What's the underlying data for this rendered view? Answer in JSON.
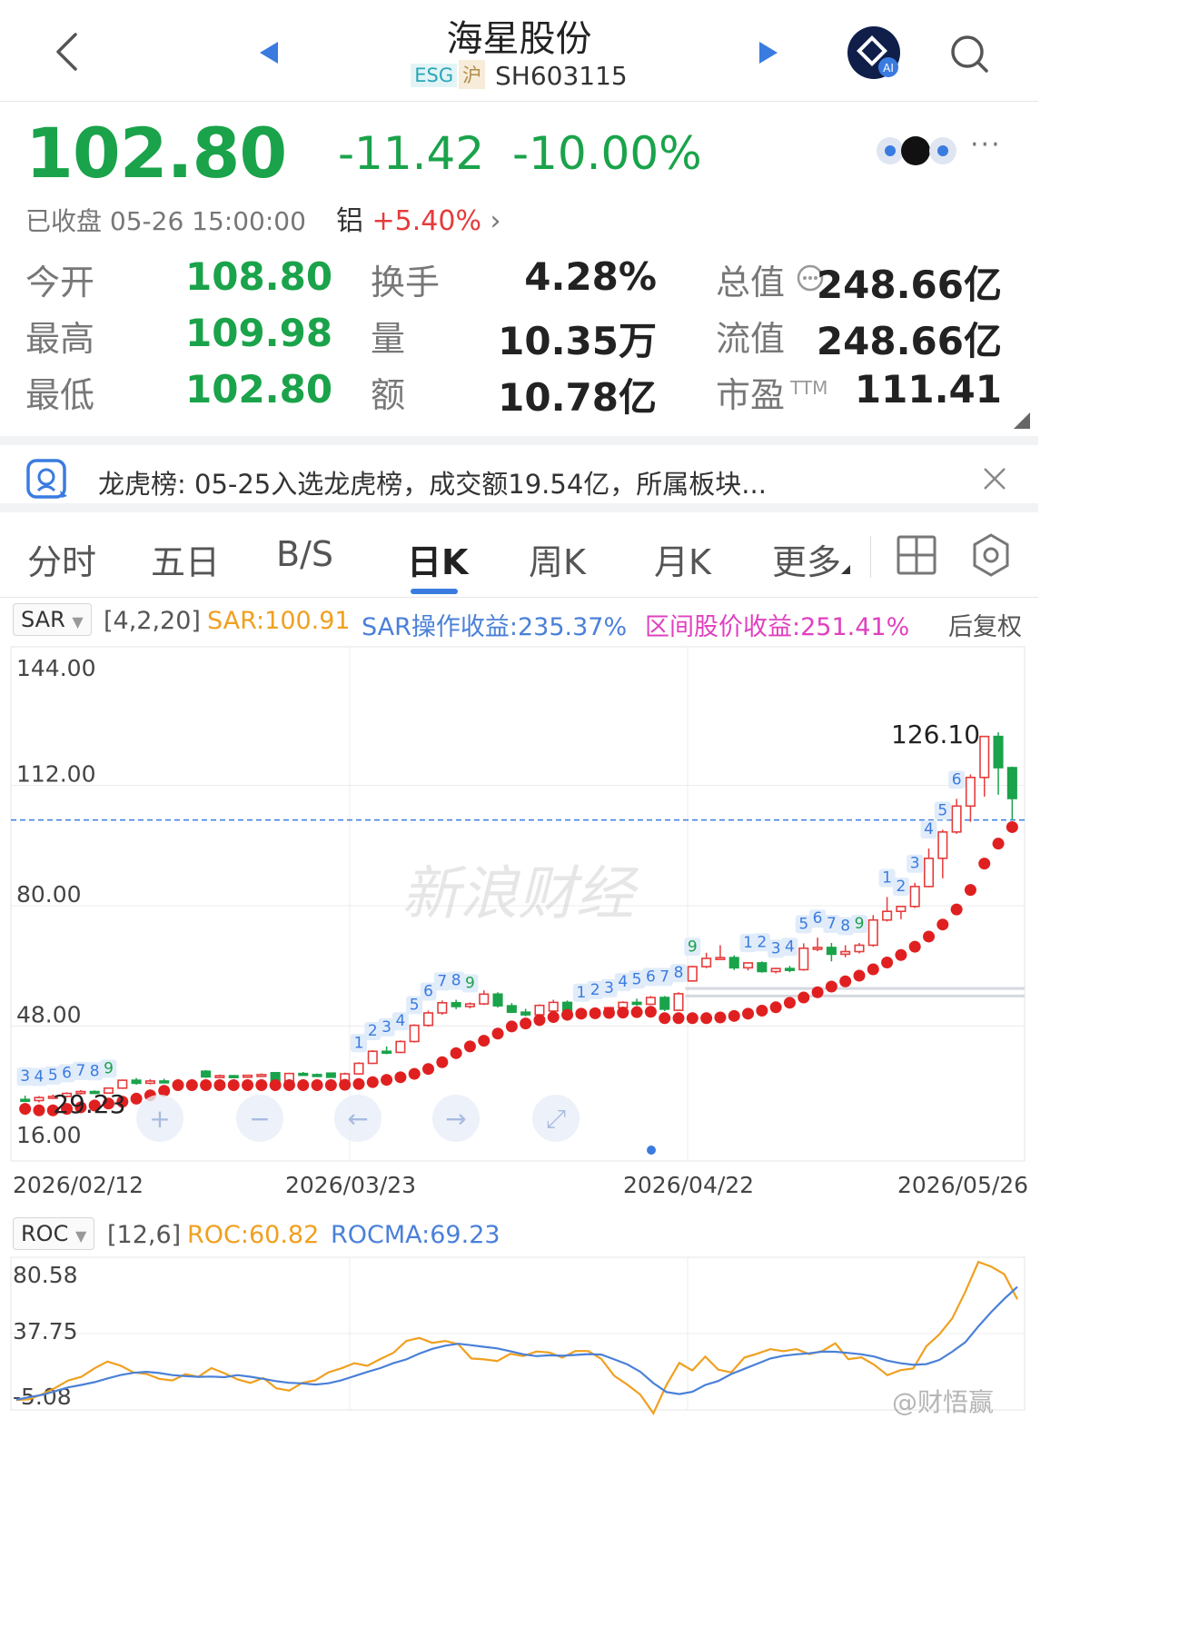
{
  "header": {
    "title": "海星股份",
    "tag_esg": "ESG",
    "tag_exchange": "沪",
    "code": "SH603115",
    "ai_badge": "AI"
  },
  "quote": {
    "price": "102.80",
    "change": "-11.42",
    "change_pct": "-10.00%",
    "status": "已收盘 05-26 15:00:00",
    "related_name": "铝",
    "related_pct": "+5.40%"
  },
  "stats": [
    [
      {
        "label": "今开",
        "value": "108.80"
      },
      {
        "label": "换手",
        "value": "4.28%"
      },
      {
        "label": "总值",
        "value": "248.66亿"
      }
    ],
    [
      {
        "label": "最高",
        "value": "109.98"
      },
      {
        "label": "量",
        "value": "10.35万"
      },
      {
        "label": "流值",
        "value": "248.66亿"
      }
    ],
    [
      {
        "label": "最低",
        "value": "102.80"
      },
      {
        "label": "额",
        "value": "10.78亿"
      },
      {
        "label": "市盈",
        "value": "111.41"
      }
    ]
  ],
  "pe_sup": "TTM",
  "banner": {
    "text": "龙虎榜: 05-25入选龙虎榜，成交额19.54亿，所属板块..."
  },
  "tabs": [
    "分时",
    "五日",
    "B/S",
    "日K",
    "周K",
    "月K",
    "更多"
  ],
  "active_tab": "日K",
  "sar": {
    "name": "SAR",
    "params": "[4,2,20]",
    "value_text": "SAR:100.91",
    "op_text": "SAR操作收益:235.37%",
    "range_text": "区间股价收益:251.41%",
    "adjust": "后复权"
  },
  "roc": {
    "name": "ROC",
    "params": "[12,6]",
    "roc_text": "ROC:60.82",
    "rocma_text": "ROCMA:69.23"
  },
  "watermark": "新浪财经",
  "footer_watermark": "@财悟赢",
  "colors": {
    "up": "#e63b3b",
    "down": "#1aa34a",
    "sar": "#e02020",
    "roc": "#f0a020",
    "rocma": "#4a80d8",
    "accent": "#3a7be0"
  },
  "chart_data": [
    {
      "type": "candlestick",
      "y_ticks": [
        "144.00",
        "112.00",
        "80.00",
        "48.00",
        "16.00"
      ],
      "ylim": [
        16,
        144
      ],
      "x_labels": [
        "2026/02/12",
        "2026/03/23",
        "2026/04/22",
        "2026/05/26"
      ],
      "high_annotation": "126.10",
      "low_annotation": "29.23",
      "last_close": 102.8,
      "series": [
        {
          "name": "K",
          "values": [
            [
              28.5,
              29.5,
              27.8,
              28.2
            ],
            [
              28.2,
              29.4,
              27.7,
              29.0
            ],
            [
              29,
              29.8,
              28.6,
              29.3
            ],
            [
              29.3,
              30.4,
              29.0,
              30.1
            ],
            [
              30.1,
              31.0,
              29.8,
              30.6
            ],
            [
              30.6,
              30.9,
              29.9,
              30.2
            ],
            [
              30.2,
              31.6,
              30.0,
              31.5
            ],
            [
              31.5,
              33.8,
              31.3,
              33.6
            ],
            [
              33.6,
              34.2,
              32.4,
              32.8
            ],
            [
              32.8,
              33.9,
              32.5,
              33.4
            ],
            [
              33.4,
              34.0,
              32.8,
              33.0
            ],
            [
              33,
              33.5,
              31.9,
              32.2
            ],
            [
              32.2,
              32.8,
              31.6,
              32.5
            ],
            [
              36,
              36.3,
              34.2,
              34.5
            ],
            [
              34.5,
              35.1,
              34.1,
              34.8
            ],
            [
              34.8,
              35.0,
              34.3,
              34.6
            ],
            [
              34.6,
              35.0,
              34.2,
              34.9
            ],
            [
              34.9,
              35.4,
              34.6,
              35.1
            ],
            [
              35.6,
              35.7,
              33.1,
              33.2
            ],
            [
              33.2,
              35.6,
              33.0,
              35.4
            ],
            [
              35.4,
              35.8,
              34.9,
              35.1
            ],
            [
              35.1,
              35.4,
              34.6,
              35.0
            ],
            [
              35.5,
              35.6,
              34.3,
              34.4
            ],
            [
              33.3,
              35.6,
              33.1,
              35.3
            ],
            [
              35.3,
              38.4,
              35.1,
              38.1
            ],
            [
              38.1,
              41.6,
              37.9,
              41.3
            ],
            [
              41.3,
              42.6,
              40.5,
              41.0
            ],
            [
              41,
              44.2,
              40.8,
              43.9
            ],
            [
              43.9,
              48.5,
              43.6,
              48.2
            ],
            [
              48.2,
              52.1,
              47.8,
              51.5
            ],
            [
              51.5,
              54.8,
              51.0,
              54.2
            ],
            [
              54.2,
              55.0,
              52.5,
              53.2
            ],
            [
              53.2,
              54.3,
              52.7,
              53.9
            ],
            [
              53.9,
              57.5,
              53.6,
              56.5
            ],
            [
              56.5,
              57.0,
              52.9,
              53.4
            ],
            [
              53.4,
              54.1,
              51.5,
              51.7
            ],
            [
              51.7,
              52.6,
              50.6,
              51.0
            ],
            [
              51,
              53.8,
              50.7,
              53.5
            ],
            [
              52,
              55.0,
              51.8,
              54.3
            ],
            [
              54.3,
              54.8,
              51.2,
              51.5
            ],
            [
              50.5,
              51.8,
              49.8,
              51.3
            ],
            [
              51.3,
              52.5,
              51.0,
              52.3
            ],
            [
              52.3,
              53.0,
              51.6,
              52.9
            ],
            [
              52.9,
              54.6,
              52.6,
              54.3
            ],
            [
              54.3,
              55.3,
              53.4,
              53.8
            ],
            [
              53.8,
              56.0,
              53.6,
              55.6
            ],
            [
              55.6,
              56.0,
              52.0,
              52.5
            ],
            [
              52.2,
              57.0,
              52.0,
              56.6
            ],
            [
              60,
              64.0,
              59.8,
              63.8
            ],
            [
              63.8,
              67.5,
              63.4,
              66.0
            ],
            [
              66,
              69.5,
              65.8,
              66.2
            ],
            [
              66.2,
              66.8,
              62.9,
              63.5
            ],
            [
              63.5,
              65.0,
              62.8,
              64.8
            ],
            [
              64.8,
              65.2,
              62.2,
              62.5
            ],
            [
              62.5,
              63.5,
              62.0,
              63.3
            ],
            [
              63.3,
              64.0,
              62.3,
              63.0
            ],
            [
              63,
              70.0,
              62.7,
              68.7
            ],
            [
              68.7,
              71.5,
              67.9,
              68.9
            ],
            [
              68.9,
              70.1,
              65.2,
              67.1
            ],
            [
              67.1,
              69.5,
              66.3,
              67.8
            ],
            [
              67.8,
              70.1,
              67.3,
              69.5
            ],
            [
              69.5,
              77.5,
              69.1,
              76.2
            ],
            [
              76.2,
              82.3,
              75.8,
              78.5
            ],
            [
              78.5,
              80.0,
              76.4,
              79.8
            ],
            [
              79.8,
              86.1,
              79.4,
              85.1
            ],
            [
              85.1,
              95.2,
              84.9,
              92.6
            ],
            [
              92.6,
              100.2,
              87.3,
              99.6
            ],
            [
              99.6,
              108.4,
              99.1,
              106.5
            ],
            [
              106.5,
              114.9,
              102.3,
              114.1
            ],
            [
              114.1,
              125.1,
              109.0,
              125.0
            ],
            [
              125,
              126.1,
              109.5,
              116.7
            ],
            [
              116.7,
              117.0,
              102.8,
              108.5
            ]
          ]
        },
        {
          "name": "SAR",
          "values": [
            26.0,
            25.6,
            25.6,
            26.0,
            26.4,
            26.9,
            27.4,
            27.9,
            28.7,
            29.6,
            30.8,
            32.3,
            32.3,
            32.3,
            32.3,
            32.3,
            32.3,
            32.3,
            32.3,
            32.3,
            32.3,
            32.3,
            32.3,
            32.4,
            32.6,
            33.1,
            33.7,
            34.4,
            35.3,
            36.6,
            38.4,
            40.8,
            42.6,
            44.1,
            46.0,
            47.9,
            48.7,
            49.6,
            50.4,
            51.0,
            51.3,
            51.4,
            51.5,
            51.6,
            51.7,
            51.8,
            50.1,
            50.1,
            50.1,
            50.1,
            50.3,
            50.7,
            51.3,
            52.1,
            53.0,
            54.2,
            55.6,
            57.0,
            58.5,
            59.9,
            61.4,
            63.1,
            64.9,
            66.9,
            69.1,
            71.8,
            75.0,
            79.0,
            84.2,
            91.2,
            96.5,
            100.9
          ]
        }
      ],
      "sar_support_lines": [
        58.0,
        56.0
      ],
      "nav_buttons": [
        "+",
        "−",
        "←",
        "→",
        "⤢"
      ]
    },
    {
      "type": "line",
      "y_ticks": [
        "80.58",
        "37.75",
        "-5.08"
      ],
      "ylim": [
        -5.08,
        80.58
      ],
      "series": [
        {
          "name": "ROC",
          "values": [
            -7.0,
            -6.5,
            -3.0,
            1.2,
            6.2,
            8.6,
            14.3,
            18.9,
            16.2,
            11.6,
            10.6,
            7.3,
            6.2,
            10.4,
            8.6,
            14.5,
            11.1,
            7.0,
            4.5,
            7.8,
            0.9,
            -0.6,
            4.6,
            6.3,
            11.6,
            14.4,
            17.8,
            16.0,
            20.6,
            24.8,
            32.8,
            34.8,
            31.5,
            32.8,
            30.6,
            21.0,
            20.4,
            19.3,
            24.1,
            22.6,
            25.7,
            25.0,
            21.6,
            26.0,
            26.0,
            20.6,
            9.3,
            3.4,
            -3.4,
            -16.0,
            3.0,
            18.0,
            12.9,
            22.3,
            13.4,
            11.6,
            21.6,
            24.2,
            27.3,
            25.9,
            27.3,
            23.9,
            26.0,
            31.2,
            20.5,
            21.7,
            16.7,
            9.7,
            13.1,
            14.3,
            29.2,
            37.2,
            48.0,
            66.0,
            86.0,
            82.8,
            77.7,
            60.8
          ]
        },
        {
          "name": "ROCMA",
          "values": [
            -6.8,
            -5.0,
            -3.5,
            -1.0,
            1.5,
            3.2,
            5.0,
            7.5,
            9.8,
            11.3,
            12.0,
            11.2,
            9.8,
            9.1,
            8.6,
            8.8,
            8.4,
            9.8,
            8.7,
            7.3,
            5.7,
            4.6,
            4.2,
            3.4,
            4.3,
            6.3,
            9.1,
            11.9,
            14.5,
            17.8,
            20.4,
            24.3,
            27.5,
            29.6,
            30.9,
            29.9,
            28.8,
            27.8,
            25.9,
            23.8,
            22.6,
            23.1,
            22.8,
            23.4,
            23.9,
            23.6,
            20.4,
            17.0,
            12.0,
            4.4,
            -1.6,
            -3.0,
            -1.5,
            3.2,
            5.8,
            10.5,
            14.0,
            17.5,
            21.0,
            22.8,
            23.8,
            24.5,
            25.6,
            25.5,
            24.7,
            23.8,
            22.3,
            19.5,
            17.8,
            16.7,
            17.2,
            20.0,
            25.6,
            32.0,
            42.6,
            52.4,
            61.2,
            69.2
          ]
        }
      ]
    }
  ]
}
